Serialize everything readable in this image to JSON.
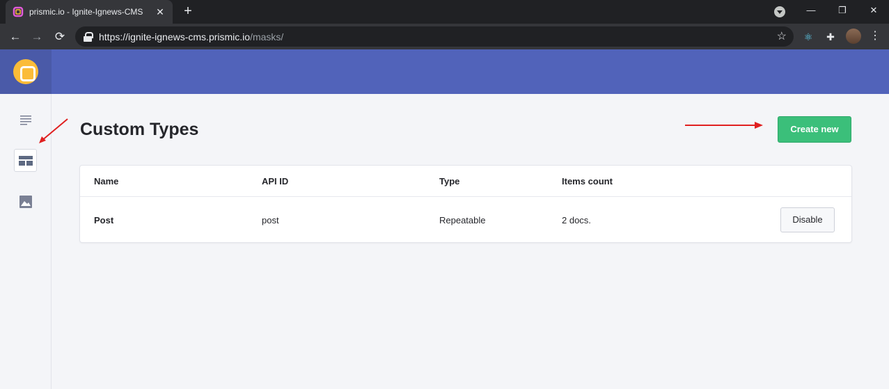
{
  "browser": {
    "tab_title": "prismic.io - Ignite-Ignews-CMS",
    "tab_close": "✕",
    "new_tab": "+",
    "url_host": "https://ignite-ignews-cms.prismic.io",
    "url_path": "/masks/",
    "back": "←",
    "forward": "→",
    "reload": "⟳",
    "bookmark": "☆",
    "minimize": "—",
    "restore": "❐",
    "close": "✕",
    "menu": "⋮",
    "puzzle": "✚",
    "react": "⚛"
  },
  "sidebar": {
    "items": [
      {
        "icon": "documents-icon"
      },
      {
        "icon": "custom-types-icon",
        "active": true
      },
      {
        "icon": "media-icon"
      }
    ]
  },
  "page": {
    "title": "Custom Types",
    "create_button": "Create new"
  },
  "table": {
    "headers": [
      "Name",
      "API ID",
      "Type",
      "Items count"
    ],
    "rows": [
      {
        "name": "Post",
        "api_id": "post",
        "type": "Repeatable",
        "count": "2 docs.",
        "action": "Disable"
      }
    ]
  },
  "colors": {
    "header": "#5163ba",
    "create_button": "#3bbf7a",
    "logo": "#fbbc38",
    "annotation_arrow": "#e02020"
  }
}
